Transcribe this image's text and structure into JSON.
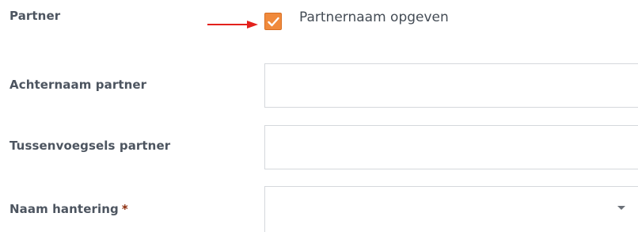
{
  "partner": {
    "label": "Partner",
    "checkbox_label": "Partnernaam opgeven",
    "checked": true
  },
  "achternaam": {
    "label": "Achternaam partner",
    "value": ""
  },
  "tussenvoegsels": {
    "label": "Tussenvoegsels partner",
    "value": ""
  },
  "naam_hantering": {
    "label": "Naam hantering",
    "required_mark": "*",
    "selected": ""
  },
  "colors": {
    "checkbox": "#f08a3c",
    "arrow": "#e3211c",
    "required": "#8b2a0a",
    "label": "#4d5560"
  },
  "icons": {
    "annotation": "red-arrow-icon",
    "check": "checkmark-icon",
    "dropdown": "chevron-down-icon"
  }
}
